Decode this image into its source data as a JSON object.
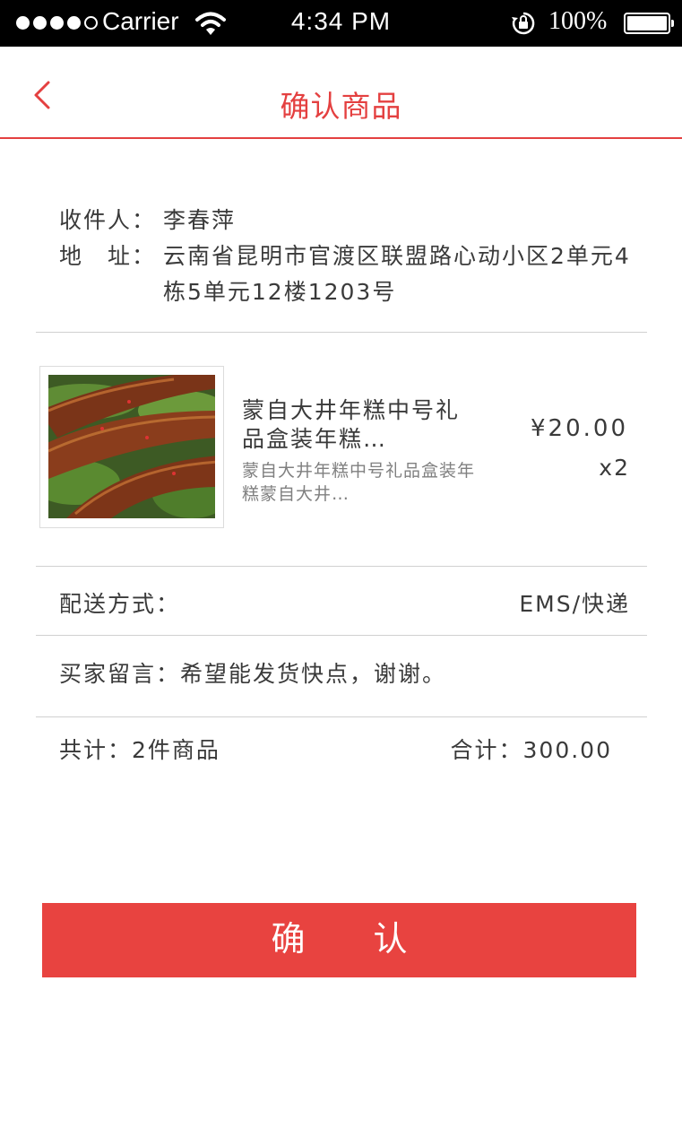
{
  "status_bar": {
    "carrier": "Carrier",
    "time": "4:34  PM",
    "battery": "100%",
    "signal_icon": "signal-dots-icon",
    "wifi_icon": "wifi-icon",
    "lock_icon": "rotation-lock-icon",
    "battery_icon": "battery-icon",
    "battery_level": 1.0
  },
  "nav": {
    "title": "确认商品",
    "back_icon": "chevron-left-icon",
    "accent_color": "#e44040"
  },
  "address": {
    "recipient_label": "收件人：",
    "recipient": "李春萍",
    "address_label": "地　址：",
    "address": "云南省昆明市官渡区联盟路心动小区2单元4栋5单元12楼1203号"
  },
  "product": {
    "title": "蒙自大井年糕中号礼品盒装年糕…",
    "description": "蒙自大井年糕中号礼品盒装年糕蒙自大井…",
    "price": "¥20.00",
    "quantity": "x2"
  },
  "delivery": {
    "label": "配送方式：",
    "value": "EMS/快递"
  },
  "message": {
    "label": "买家留言：",
    "value": "希望能发货快点，谢谢。"
  },
  "summary": {
    "count_label": "共计：",
    "count": "2件商品",
    "total_label": "合计：",
    "total": "300.00"
  },
  "confirm_button": {
    "label": "确　　认",
    "color": "#e84340"
  }
}
